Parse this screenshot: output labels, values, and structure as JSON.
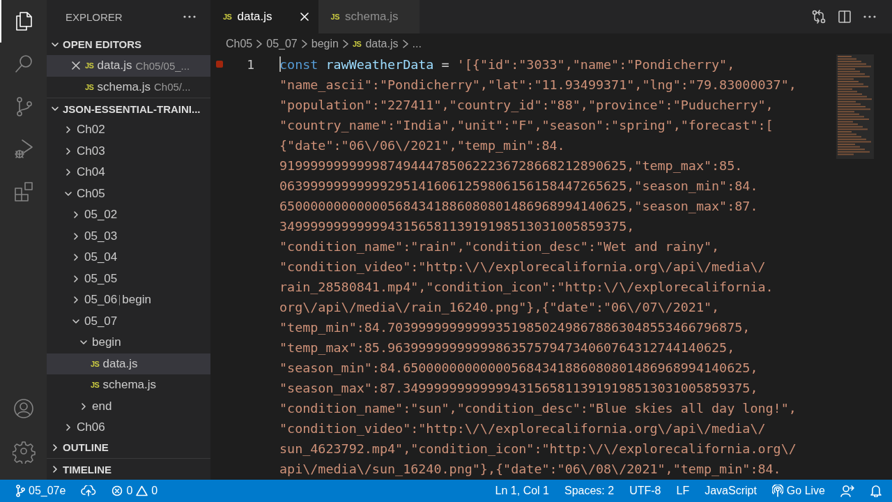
{
  "activity_bar": {
    "items": [
      {
        "kind": "files",
        "selected": true
      },
      {
        "kind": "search",
        "selected": false
      },
      {
        "kind": "source-control",
        "selected": false
      },
      {
        "kind": "run-debug",
        "selected": false
      },
      {
        "kind": "extensions",
        "selected": false
      }
    ],
    "bottom": [
      {
        "kind": "account"
      },
      {
        "kind": "settings"
      }
    ]
  },
  "sidebar": {
    "title": "EXPLORER",
    "sections": [
      {
        "title": "OPEN EDITORS",
        "expanded": true,
        "kind": "open-editors",
        "items": [
          {
            "icon": "JS",
            "name": "data.js",
            "path": "Ch05/05_...",
            "selected": true
          },
          {
            "icon": "JS",
            "name": "schema.js",
            "path": "Ch05/...",
            "selected": false
          }
        ]
      },
      {
        "title": "JSON-ESSENTIAL-TRAINI...",
        "expanded": true,
        "kind": "tree",
        "items": [
          {
            "kind": "folder",
            "name": "Ch02",
            "expanded": false,
            "selected": false
          },
          {
            "kind": "folder",
            "name": "Ch03",
            "expanded": false,
            "selected": false
          },
          {
            "kind": "folder",
            "name": "Ch04",
            "expanded": false,
            "selected": false
          },
          {
            "kind": "folder",
            "name": "Ch05",
            "expanded": true,
            "selected": false,
            "children": [
              {
                "kind": "folder",
                "name": "05_02",
                "expanded": false,
                "selected": false
              },
              {
                "kind": "folder",
                "name": "05_03",
                "expanded": false,
                "selected": false
              },
              {
                "kind": "folder",
                "name": "05_04",
                "expanded": false,
                "selected": false
              },
              {
                "kind": "folder",
                "name": "05_05",
                "expanded": false,
                "selected": false
              },
              {
                "kind": "folder",
                "name": "05_06",
                "compact": "begin",
                "expanded": false,
                "selected": false
              },
              {
                "kind": "folder",
                "name": "05_07",
                "expanded": true,
                "selected": false,
                "children": [
                  {
                    "kind": "folder",
                    "name": "begin",
                    "expanded": true,
                    "selected": false,
                    "children": [
                      {
                        "kind": "file",
                        "icon": "JS",
                        "name": "data.js",
                        "selected": true
                      },
                      {
                        "kind": "file",
                        "icon": "JS",
                        "name": "schema.js",
                        "selected": false
                      }
                    ]
                  },
                  {
                    "kind": "folder",
                    "name": "end",
                    "expanded": false,
                    "selected": false
                  }
                ]
              }
            ]
          },
          {
            "kind": "folder",
            "name": "Ch06",
            "expanded": false,
            "selected": false
          }
        ]
      },
      {
        "title": "OUTLINE",
        "expanded": false
      },
      {
        "title": "TIMELINE",
        "expanded": false
      }
    ]
  },
  "tabs": [
    {
      "icon": "JS",
      "label": "data.js",
      "selected": true
    },
    {
      "icon": "JS",
      "label": "schema.js",
      "selected": false
    }
  ],
  "breadcrumb": [
    {
      "label": "Ch05"
    },
    {
      "label": "05_07"
    },
    {
      "label": "begin"
    },
    {
      "label": "data.js",
      "icon": "JS"
    },
    {
      "label": "..."
    }
  ],
  "code": {
    "line_number": "1",
    "breakpoint": true,
    "first": [
      {
        "kind": "keyword",
        "text": "const "
      },
      {
        "kind": "variable",
        "text": "rawWeatherData"
      },
      {
        "kind": "operator",
        "text": " = "
      },
      {
        "kind": "string",
        "text": "'[{\"id\":\"3033\",\"name\":\"Pondicherry\","
      }
    ],
    "wrapped": [
      "\"name_ascii\":\"Pondicherry\",\"lat\":\"11.93499371\",\"lng\":\"79.83000037\",",
      "\"population\":\"227411\",\"country_id\":\"88\",\"province\":\"Puducherry\",",
      "\"country_name\":\"India\",\"unit\":\"F\",\"season\":\"spring\",\"forecast\":[",
      "{\"date\":\"06\\/06\\/2021\",\"temp_min\":84.",
      "919999999999987494447850622236728668212890625,\"temp_max\":85.",
      "063999999999992951416061259806156158447265625,\"season_min\":84.",
      "650000000000005684341886080801486968994140625,\"season_max\":87.",
      "349999999999994315658113919198513031005859375,",
      "\"condition_name\":\"rain\",\"condition_desc\":\"Wet and rainy\",",
      "\"condition_video\":\"http:\\/\\/explorecalifornia.org\\/api\\/media\\/",
      "rain_28580841.mp4\",\"condition_icon\":\"http:\\/\\/explorecalifornia.",
      "org\\/api\\/media\\/rain_16240.png\"},{\"date\":\"06\\/07\\/2021\",",
      "\"temp_min\":84.7039999999999935198502498678863048553466796875,",
      "\"temp_max\":85.96399999999999863575794734060764312744140625,",
      "\"season_min\":84.650000000000005684341886080801486968994140625,",
      "\"season_max\":87.349999999999994315658113919198513031005859375,",
      "\"condition_name\":\"sun\",\"condition_desc\":\"Blue skies all day long!\",",
      "\"condition_video\":\"http:\\/\\/explorecalifornia.org\\/api\\/media\\/",
      "sun_4623792.mp4\",\"condition_icon\":\"http:\\/\\/explorecalifornia.org\\/",
      "api\\/media\\/sun_16240.png\"},{\"date\":\"06\\/08\\/2021\",\"temp_min\":84."
    ]
  },
  "status_bar": {
    "branch": "05_07e",
    "errors": "0",
    "warnings": "0",
    "right": [
      {
        "kind": "text",
        "label": "Ln 1, Col 1"
      },
      {
        "kind": "text",
        "label": "Spaces: 2"
      },
      {
        "kind": "text",
        "label": "UTF-8"
      },
      {
        "kind": "text",
        "label": "LF"
      },
      {
        "kind": "text",
        "label": "JavaScript"
      },
      {
        "kind": "live",
        "label": "Go Live"
      },
      {
        "kind": "feedback"
      },
      {
        "kind": "bell"
      }
    ]
  }
}
